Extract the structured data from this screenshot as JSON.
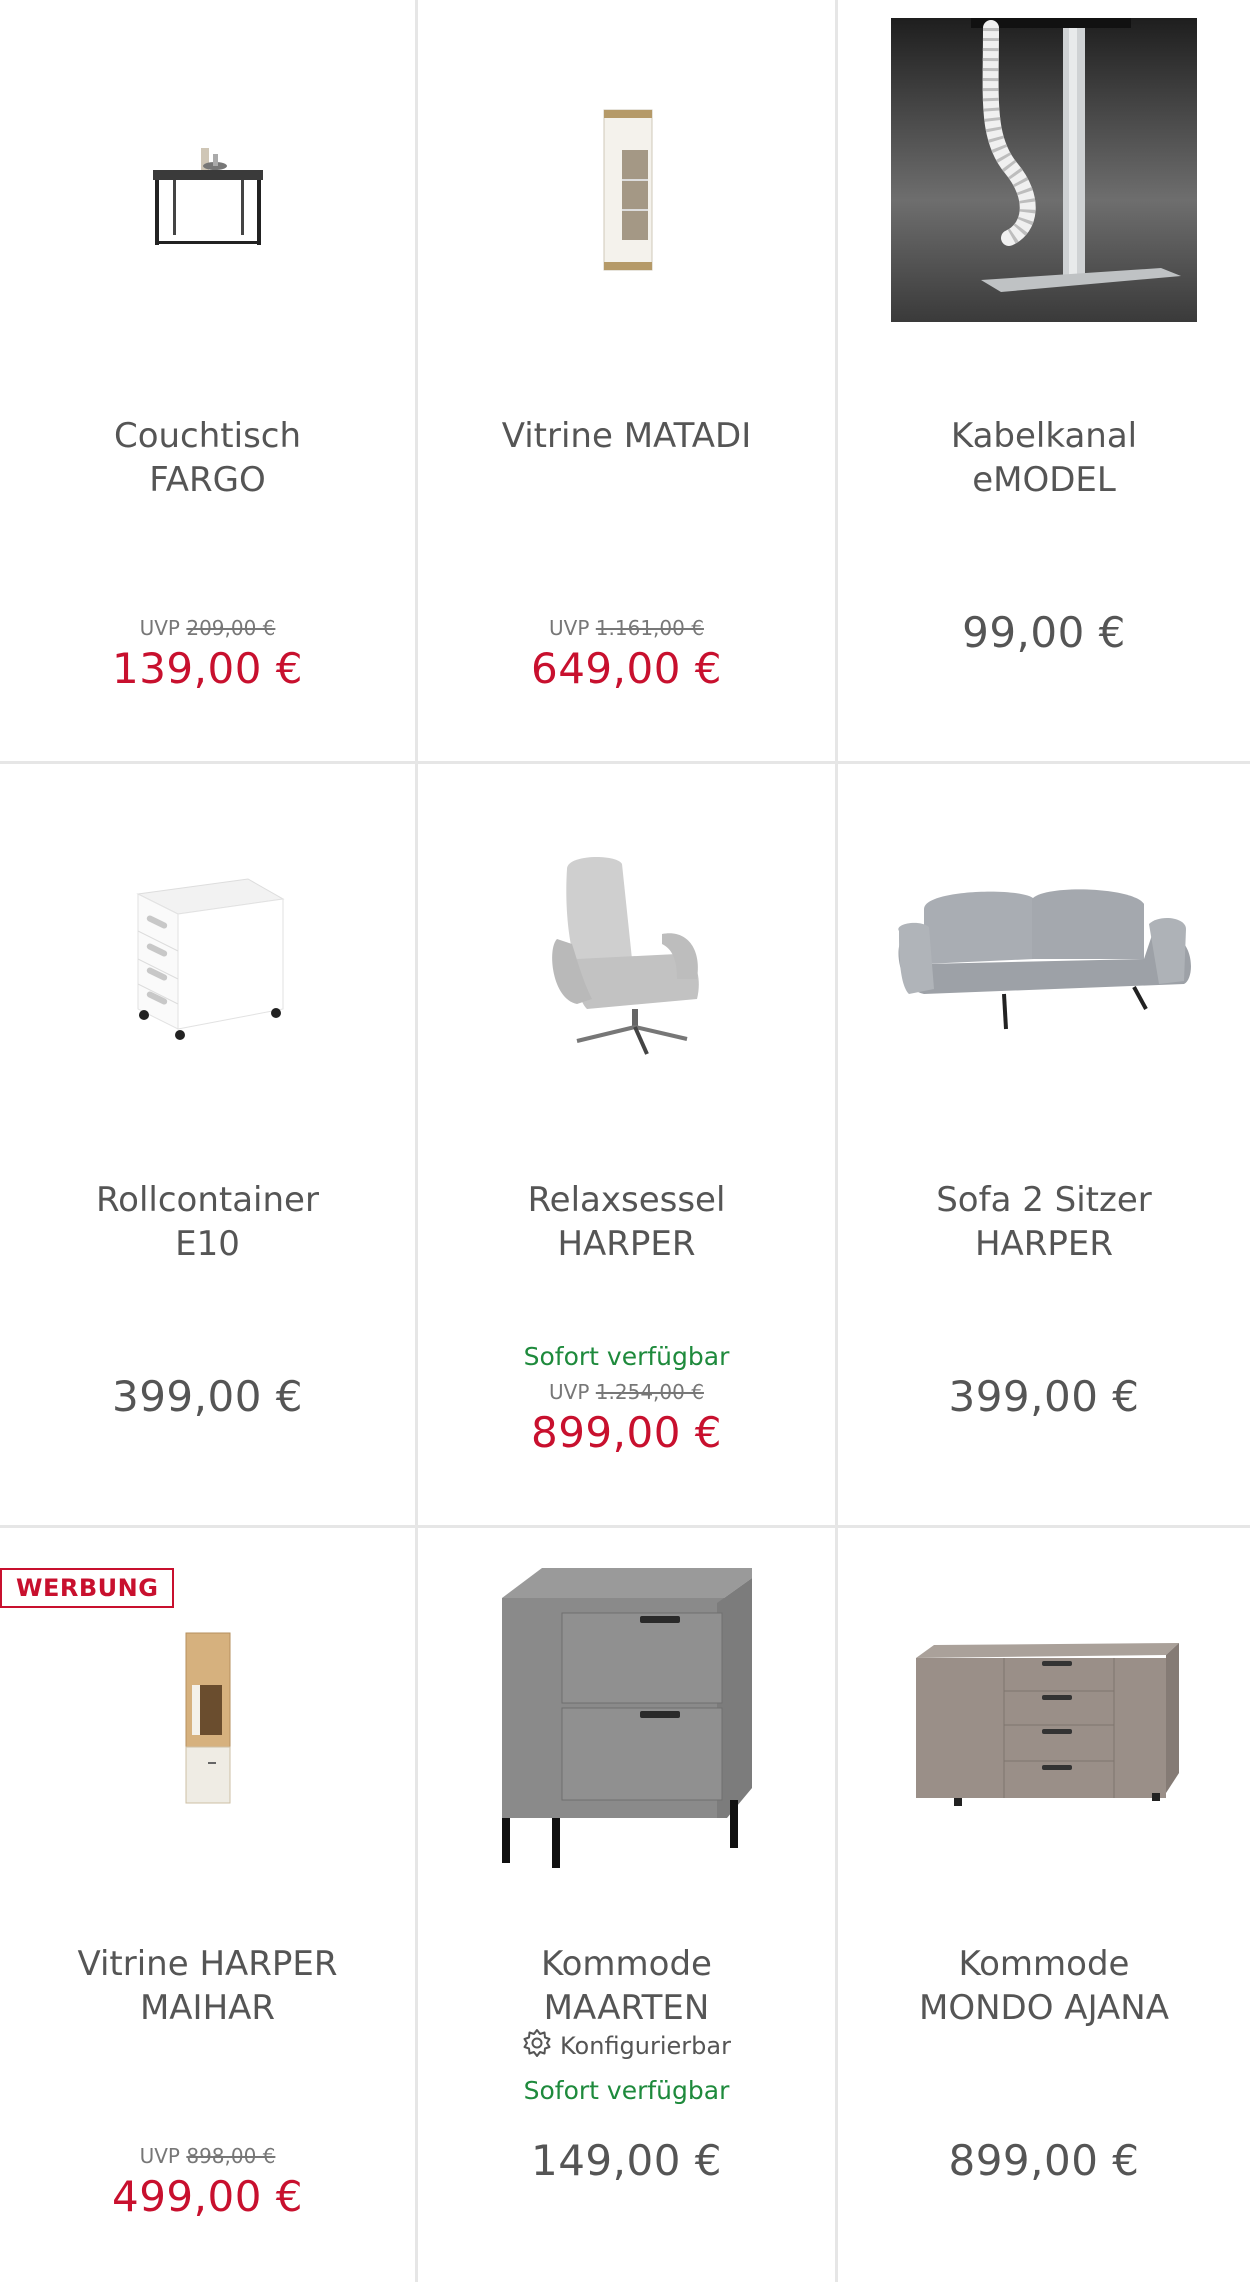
{
  "products": [
    {
      "name": "Couchtisch\nFARGO",
      "uvp_label": "UVP",
      "uvp_price": "209,00 €",
      "price": "139,00 €",
      "icon": "coffee-table-image"
    },
    {
      "name": "Vitrine MATADI",
      "uvp_label": "UVP",
      "uvp_price": "1.161,00 €",
      "price": "649,00 €",
      "icon": "vitrine-image"
    },
    {
      "name": "Kabelkanal\neMODEL",
      "price": "99,00 €",
      "icon": "cable-channel-image"
    },
    {
      "name": "Rollcontainer\nE10",
      "price": "399,00 €",
      "icon": "drawer-container-image"
    },
    {
      "name": "Relaxsessel\nHARPER",
      "availability": "Sofort verfügbar",
      "uvp_label": "UVP",
      "uvp_price": "1.254,00 €",
      "price": "899,00 €",
      "icon": "recliner-image"
    },
    {
      "name": "Sofa 2 Sitzer\nHARPER",
      "price": "399,00 €",
      "icon": "sofa-image"
    },
    {
      "name": "Vitrine HARPER\nMAIHAR",
      "badge": "WERBUNG",
      "uvp_label": "UVP",
      "uvp_price": "898,00 €",
      "price": "499,00 €",
      "icon": "wood-vitrine-image"
    },
    {
      "name": "Kommode\nMAARTEN",
      "configurable": "Konfigurierbar",
      "availability": "Sofort verfügbar",
      "price": "149,00 €",
      "icon": "nightstand-image"
    },
    {
      "name": "Kommode\nMONDO AJANA",
      "price": "899,00 €",
      "icon": "sideboard-image"
    }
  ],
  "colors": {
    "sale": "#c8102e",
    "available": "#1e8a3c",
    "text": "#555555",
    "divider": "#e6e6e6"
  }
}
